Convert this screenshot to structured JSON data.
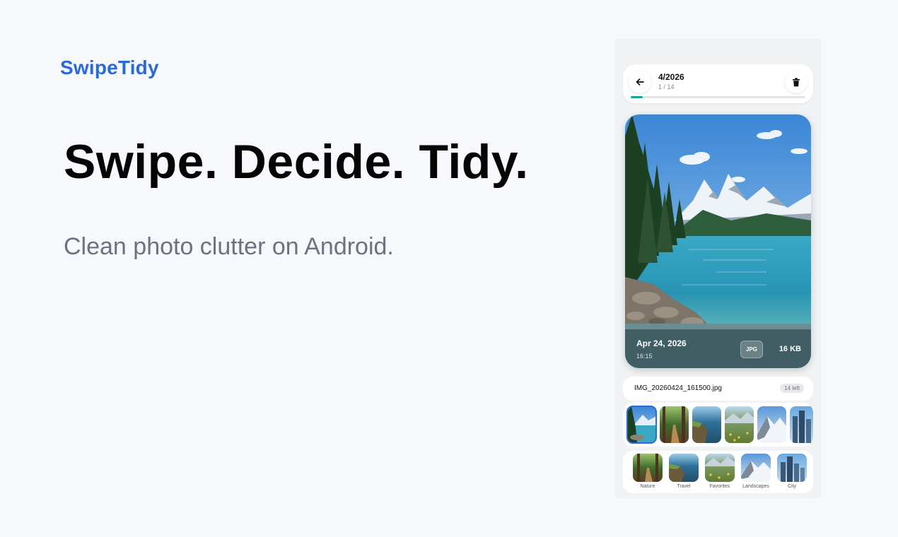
{
  "brand": "SwipeTidy",
  "headline": "Swipe. Decide. Tidy.",
  "tagline": "Clean photo clutter on Android.",
  "colors": {
    "brand": "#2a6ad8",
    "progress": "#17a59a",
    "background": "#f6f8fb"
  },
  "app": {
    "topbar": {
      "title": "4/2026",
      "counter": "1 / 14",
      "progress": 0.07,
      "back_icon": "arrow-left-icon",
      "delete_icon": "trash-icon"
    },
    "photo": {
      "date": "Apr 24, 2026",
      "time": "16:15",
      "format": "JPG",
      "size": "16 KB"
    },
    "file": {
      "name": "IMG_20260424_161500.jpg",
      "remaining": "14 left"
    },
    "albums": [
      {
        "label": "Nature"
      },
      {
        "label": "Travel"
      },
      {
        "label": "Favorites"
      },
      {
        "label": "Landscapes"
      },
      {
        "label": "City"
      }
    ]
  }
}
